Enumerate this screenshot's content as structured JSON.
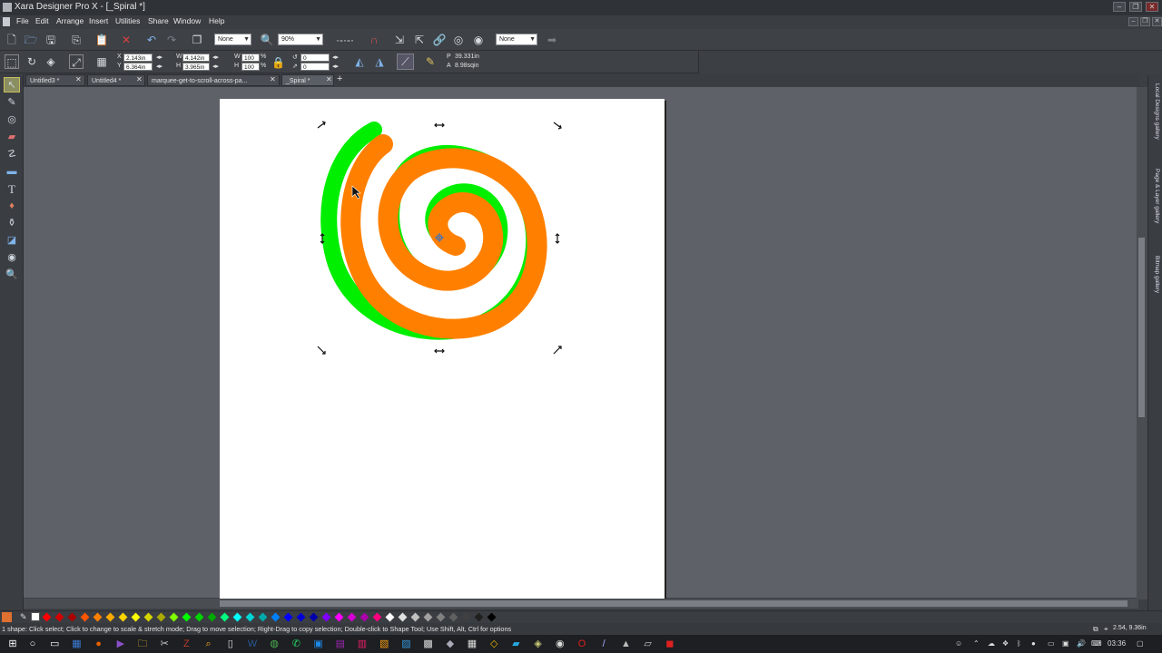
{
  "window": {
    "title": "Xara Designer Pro X - [_Spiral *]",
    "controls": [
      "–",
      "❐",
      "✕"
    ],
    "doc_controls": [
      "–",
      "❐",
      "✕"
    ]
  },
  "menu": [
    "File",
    "Edit",
    "Arrange",
    "Insert",
    "Utilities",
    "Share",
    "Window",
    "Help"
  ],
  "toolbar": {
    "quality_combo": "None",
    "zoom_combo": "90%",
    "effect_combo": "None",
    "icons": [
      "new-icon",
      "open-icon",
      "save-icon",
      "copy-icon",
      "paste-icon",
      "delete-icon",
      "undo-icon",
      "redo-icon",
      "bring-front-icon",
      "zoom-icon",
      "snap-icon",
      "magnet-icon",
      "import-icon",
      "export-icon",
      "link-icon",
      "web-preview-icon",
      "web-publish-icon",
      "forward-icon"
    ]
  },
  "infobar": {
    "x_label": "X",
    "x_value": "2.143in",
    "y_label": "Y",
    "y_value": "6.364in",
    "w_label": "W",
    "w_value": "4.142in",
    "h_label": "H",
    "h_value": "3.965in",
    "sw_label": "W",
    "sw_value": "100",
    "sh_label": "H",
    "sh_value": "100",
    "pct": "%",
    "rot_value": "0",
    "skew_value": "0",
    "p_label": "P",
    "perimeter": "39.331in",
    "a_label": "A",
    "area": "8.98sqin"
  },
  "tabs": [
    {
      "label": "Untitled3 *",
      "active": false
    },
    {
      "label": "Untitled4 *",
      "active": false
    },
    {
      "label": "marquee-get-to-scroll-across-pa...",
      "active": false
    },
    {
      "label": "_Spiral *",
      "active": true
    }
  ],
  "tab_add": "+",
  "tools": [
    "selector-icon",
    "freehand-icon",
    "contour-icon",
    "eraser-icon",
    "shape-editor-icon",
    "rectangle-icon",
    "text-icon",
    "fill-icon",
    "transparency-icon",
    "shadow-icon",
    "bevel-icon",
    "zoom-tool-icon"
  ],
  "right_tabs": [
    "Local Designs gallery",
    "Page & Layer gallery",
    "Bitmap gallery"
  ],
  "colors": {
    "spiral_green": "#00ee00",
    "spiral_orange": "#ff8000",
    "palette": [
      "#ff0000",
      "#d40000",
      "#aa0000",
      "#ff5500",
      "#ff8000",
      "#ffaa00",
      "#ffd400",
      "#ffff00",
      "#d4d400",
      "#aaaa00",
      "#80ff00",
      "#00ff00",
      "#00d400",
      "#00aa00",
      "#00ff80",
      "#00ffff",
      "#00d4d4",
      "#00aaaa",
      "#0080ff",
      "#0000ff",
      "#0000d4",
      "#0000aa",
      "#8000ff",
      "#ff00ff",
      "#d400d4",
      "#aa00aa",
      "#ff0080",
      "#ffffff",
      "#e0e0e0",
      "#c0c0c0",
      "#a0a0a0",
      "#808080",
      "#606060",
      "#404040",
      "#202020",
      "#000000"
    ]
  },
  "status": {
    "message": "1 shape: Click select; Click to change to scale & stretch mode; Drag to move selection; Right-Drag to copy selection; Double-click to Shape Tool; Use Shift, Alt, Ctrl for options",
    "coords": "2.54, 9.36in"
  },
  "taskbar": {
    "time": "03:36",
    "icons": [
      "windows-start-icon",
      "search-icon",
      "task-view-icon",
      "app1-icon",
      "firefox-icon",
      "xara-icon",
      "explorer-icon",
      "tool-icon",
      "filezilla-icon",
      "search2-icon",
      "notepad-icon",
      "word-icon",
      "chrome-icon",
      "whatsapp-icon",
      "app2-icon",
      "app3-icon",
      "app4-icon",
      "app5-icon",
      "app6-icon",
      "app7-icon",
      "app8-icon",
      "calc-icon",
      "app9-icon",
      "app10-icon",
      "app11-icon",
      "app12-icon",
      "opera-icon",
      "pen-icon",
      "app13-icon",
      "app14-icon",
      "pdf-icon"
    ]
  }
}
